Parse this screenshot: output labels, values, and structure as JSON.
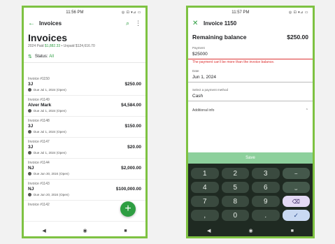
{
  "left": {
    "status": {
      "time": "11:56 PM",
      "right": "◎ ⊡ ▾⊿ ▭"
    },
    "appbar": {
      "back_icon": "←",
      "title": "Invoices",
      "search_icon": "⌕",
      "menu_icon": "⋮"
    },
    "page_title": "Invoices",
    "summary": {
      "prefix": "2024 Paid",
      "paid": "$1,882.33",
      "rest": "• Unpaid $124,616.70"
    },
    "filter": {
      "icon": "⇅",
      "label": "Status:",
      "value": "All"
    },
    "invoices": [
      {
        "number": "Invoice #1150",
        "customer": "3J",
        "amount": "$250.00",
        "due": "Due Jul 1, 2024 (Open)"
      },
      {
        "number": "Invoice #1149",
        "customer": "Alver Mark",
        "amount": "$4,584.00",
        "due": "Due Jul 1, 2024 (Open)"
      },
      {
        "number": "Invoice #1148",
        "customer": "3J",
        "amount": "$150.00",
        "due": "Due Jul 1, 2024 (Open)"
      },
      {
        "number": "Invoice #1147",
        "customer": "3J",
        "amount": "$20.00",
        "due": "Due Jul 1, 2024 (Open)"
      },
      {
        "number": "Invoice #1144",
        "customer": "NJ",
        "amount": "$2,000.00",
        "due": "Due Jun 30, 2024 (Open)"
      },
      {
        "number": "Invoice #1143",
        "customer": "NJ",
        "amount": "$100,000.00",
        "due": "Due Jun 20, 2024 (Open)"
      },
      {
        "number": "Invoice #1142",
        "customer": "",
        "amount": "",
        "due": ""
      }
    ],
    "fab": "+",
    "nav": {
      "back": "◀",
      "home": "◉",
      "recents": "■"
    }
  },
  "right": {
    "status": {
      "time": "11:57 PM",
      "right": "◎ ⊡ ▾⊿ ▭"
    },
    "appbar": {
      "close_icon": "✕",
      "title": "Invoice 1150"
    },
    "remaining": {
      "label": "Remaining balance",
      "value": "$250.00"
    },
    "payment": {
      "label": "Payment",
      "value": "$25000",
      "error": "The payment can't be more than the invoice balance."
    },
    "date": {
      "label": "Date",
      "value": "Jun 1, 2024"
    },
    "method": {
      "label": "Select a payment method",
      "value": "Cash"
    },
    "additional": {
      "label": "Additional info",
      "icon": "⌃"
    },
    "save": "Save",
    "keys": [
      "1",
      "2",
      "3",
      "−",
      "4",
      "5",
      "6",
      "⎵",
      "7",
      "8",
      "9",
      "⌫",
      ",",
      "0",
      ".",
      "✓"
    ],
    "nav": {
      "back": "◀",
      "home": "◉",
      "recents": "■"
    }
  }
}
